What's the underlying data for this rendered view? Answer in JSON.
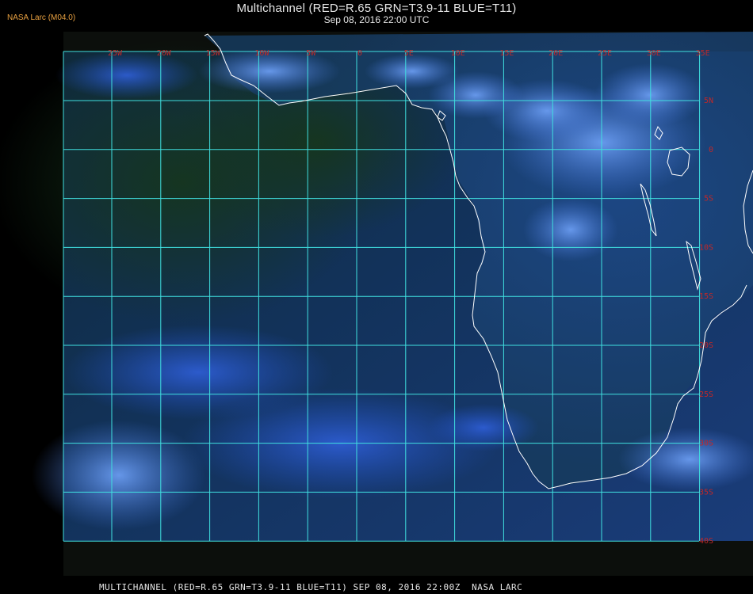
{
  "header": {
    "title": "Multichannel (RED=R.65 GRN=T3.9-11 BLUE=T11)",
    "subtitle": "Sep 08, 2016 22:00 UTC",
    "credit": "NASA Larc (M04.0)"
  },
  "footer": {
    "text": "MULTICHANNEL (RED=R.65 GRN=T3.9-11 BLUE=T11) SEP 08, 2016 22:00Z  NASA LARC"
  },
  "grid": {
    "longitude_labels": [
      "25W",
      "20W",
      "15W",
      "10W",
      "5W",
      "0",
      "5E",
      "10E",
      "15E",
      "20E",
      "25E",
      "30E",
      "35E"
    ],
    "latitude_labels": [
      "5N",
      "0",
      "5S",
      "10S",
      "15S",
      "20S",
      "25S",
      "30S",
      "35S",
      "40S"
    ]
  },
  "colors": {
    "gridline": "#40e0e0",
    "label": "#c02828",
    "coastline": "#ffffff",
    "credit": "#e8a040"
  }
}
